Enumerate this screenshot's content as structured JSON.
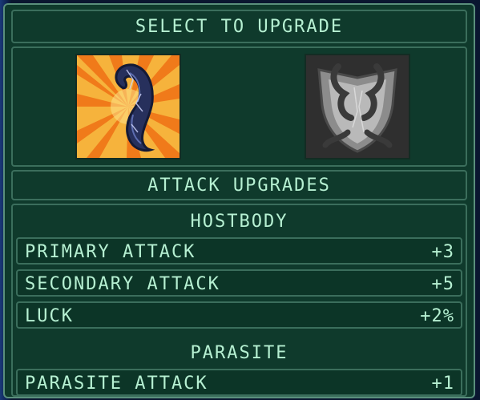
{
  "header": {
    "title": "SELECT TO UPGRADE"
  },
  "choices": [
    {
      "icon": "tentacle-attack-icon",
      "selected": true
    },
    {
      "icon": "shield-defense-icon",
      "selected": false
    }
  ],
  "attack_header": "ATTACK UPGRADES",
  "hostbody": {
    "title": "HOSTBODY",
    "stats": [
      {
        "label": "PRIMARY ATTACK",
        "value": "+3"
      },
      {
        "label": "SECONDARY ATTACK",
        "value": "+5"
      },
      {
        "label": "LUCK",
        "value": "+2%"
      }
    ]
  },
  "parasite": {
    "title": "PARASITE",
    "stats": [
      {
        "label": "PARASITE ATTACK",
        "value": "+1"
      }
    ]
  },
  "colors": {
    "panel_bg": "#0f3a2c",
    "text": "#b6f0d2",
    "border": "#3b6e5c",
    "accent_orange": "#f39a2a"
  }
}
